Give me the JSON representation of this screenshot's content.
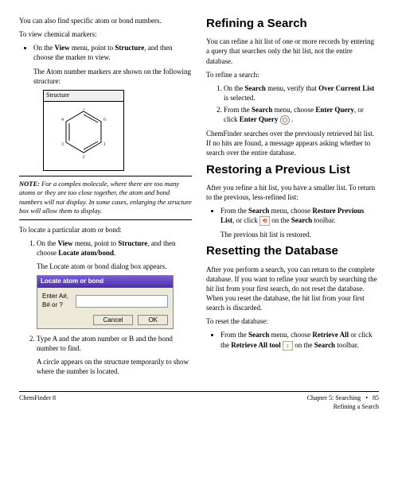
{
  "left": {
    "intro1": "You can also find specific atom or bond numbers.",
    "intro2": "To view chemical markers:",
    "bullet1a": "On the ",
    "bullet1_view": "View",
    "bullet1b": " menu, point to ",
    "bullet1_structure": "Structure",
    "bullet1c": ", and then choose the marker to view.",
    "indent1": "The Atom number markers are shown on the following structure:",
    "structure_title": "Structure",
    "note_label": "NOTE:",
    "note_text": "  For a complex molecule, where there are too many atoms or they are too close together, the atom and bond numbers will not display. In some cases, enlarging the structure box will allow them to display.",
    "locate_intro": "To locate a particular atom or bond:",
    "num1a": "On the ",
    "num1_view": "View",
    "num1b": " menu, point to ",
    "num1_structure": "Structure",
    "num1c": ", and then choose ",
    "num1_locate": "Locate atom/bond",
    "num1d": ".",
    "indent2": "The Locate atom or bond dialog box appears.",
    "dialog_title": "Locate atom or bond",
    "dialog_label": "Enter A#, B# or ?",
    "dialog_cancel": "Cancel",
    "dialog_ok": "OK",
    "num2": "Type A and the atom number or B and the bond number to find.",
    "indent3": "A circle appears on the structure temporarily to show where the number is located."
  },
  "right": {
    "h1": "Refining a Search",
    "p1": "You can refine a hit list of one or more records by entering a query that searches only the hit list, not the entire database.",
    "p2": "To refine a search:",
    "r1a": "On the ",
    "r1_search": "Search",
    "r1b": " menu, verify that ",
    "r1_over": "Over Current List",
    "r1c": " is selected.",
    "r2a": "From the ",
    "r2_search": "Search",
    "r2b": " menu, choose ",
    "r2_enter": "Enter Query",
    "r2c": ", or click ",
    "r2_enterbtn": "Enter Query",
    "r2d": " .",
    "p3": "ChemFinder searches over the previously retrieved hit list. If no hits are found, a message appears asking whether to search over the entire database.",
    "h2": "Restoring a Previous List",
    "p4": "After you refine a hit list, you have a smaller list. To return to the previous, less-refined list:",
    "b1a": "From the ",
    "b1_search": "Search",
    "b1b": " menu, choose ",
    "b1_restore": "Restore Previous List",
    "b1c": ", or click ",
    "b1d": " on the ",
    "b1_searchtb": "Search",
    "b1e": " toolbar.",
    "indentR1": "The previous hit list is restored.",
    "h3": "Resetting the Database",
    "p5": "After you perform a search, you can return to the complete database. If you want to refine your search by searching the hit list from your first search, do not reset the database. When you reset the database, the hit list from your first search is discarded.",
    "p6": "To reset the database:",
    "b2a": "From the ",
    "b2_search": "Search",
    "b2b": " menu, choose ",
    "b2_retrieve": "Retrieve All",
    "b2c": " or click the ",
    "b2_tool": "Retrieve All tool",
    "b2d": "  on the ",
    "b2_searchtb": "Search",
    "b2e": " toolbar."
  },
  "footer": {
    "left": "ChemFinder 8",
    "right1": "Chapter 5: Searching",
    "dot": "•",
    "pagenum": "85",
    "right2": "Refining a Search"
  }
}
